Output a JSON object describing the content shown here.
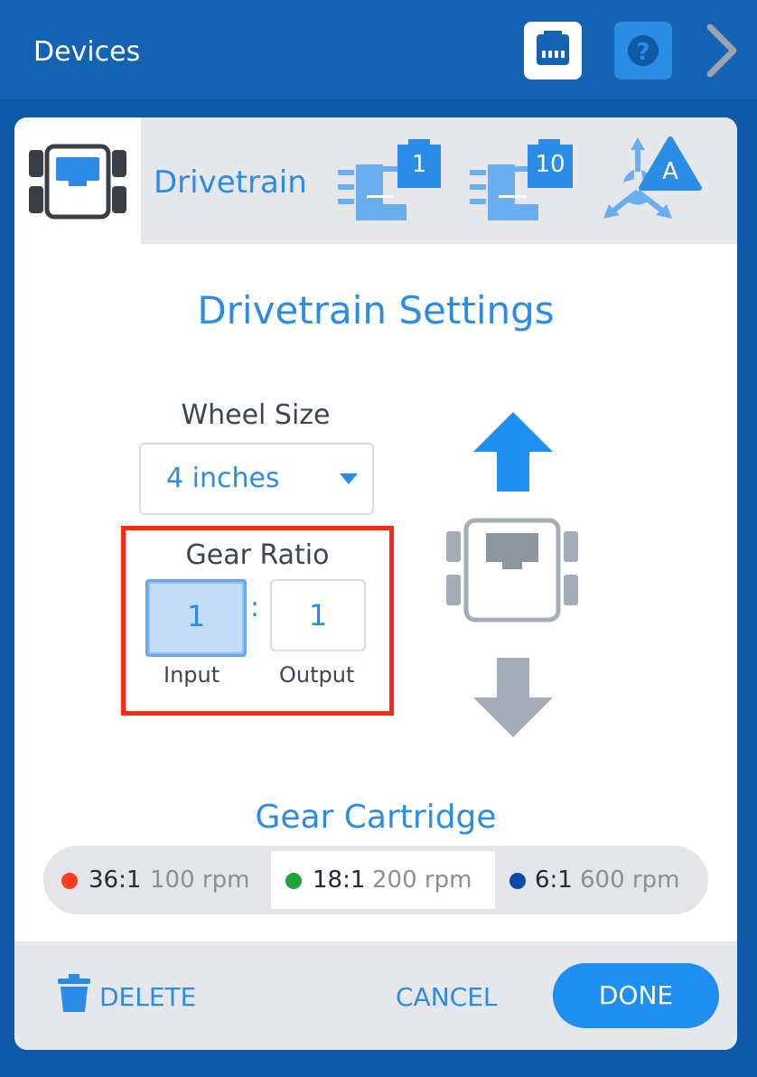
{
  "header": {
    "title": "Devices",
    "port_icon": "ethernet-port-icon",
    "help_icon": "help-icon",
    "next_icon": "chevron-right-icon"
  },
  "tabs": {
    "active_label": "Drivetrain",
    "motor1_badge": "1",
    "motor2_badge": "10",
    "sensor_badge": "A"
  },
  "settings": {
    "heading": "Drivetrain Settings",
    "wheel_size_label": "Wheel Size",
    "wheel_size_value": "4 inches",
    "gear_ratio_label": "Gear Ratio",
    "gear_input": "1",
    "gear_separator": ":",
    "gear_output": "1",
    "input_caption": "Input",
    "output_caption": "Output"
  },
  "cartridge": {
    "heading": "Gear Cartridge",
    "options": [
      {
        "ratio": "36:1",
        "rpm": "100 rpm",
        "color": "#ff3b24",
        "selected": false
      },
      {
        "ratio": "18:1",
        "rpm": "200 rpm",
        "color": "#1fa33a",
        "selected": true
      },
      {
        "ratio": "6:1",
        "rpm": "600 rpm",
        "color": "#0b4aa8",
        "selected": false
      }
    ]
  },
  "footer": {
    "delete_label": "DELETE",
    "cancel_label": "CANCEL",
    "done_label": "DONE"
  },
  "colors": {
    "accent": "#2b8ce6",
    "header_bg": "#1462b4",
    "highlight_border": "#ff2a12"
  }
}
